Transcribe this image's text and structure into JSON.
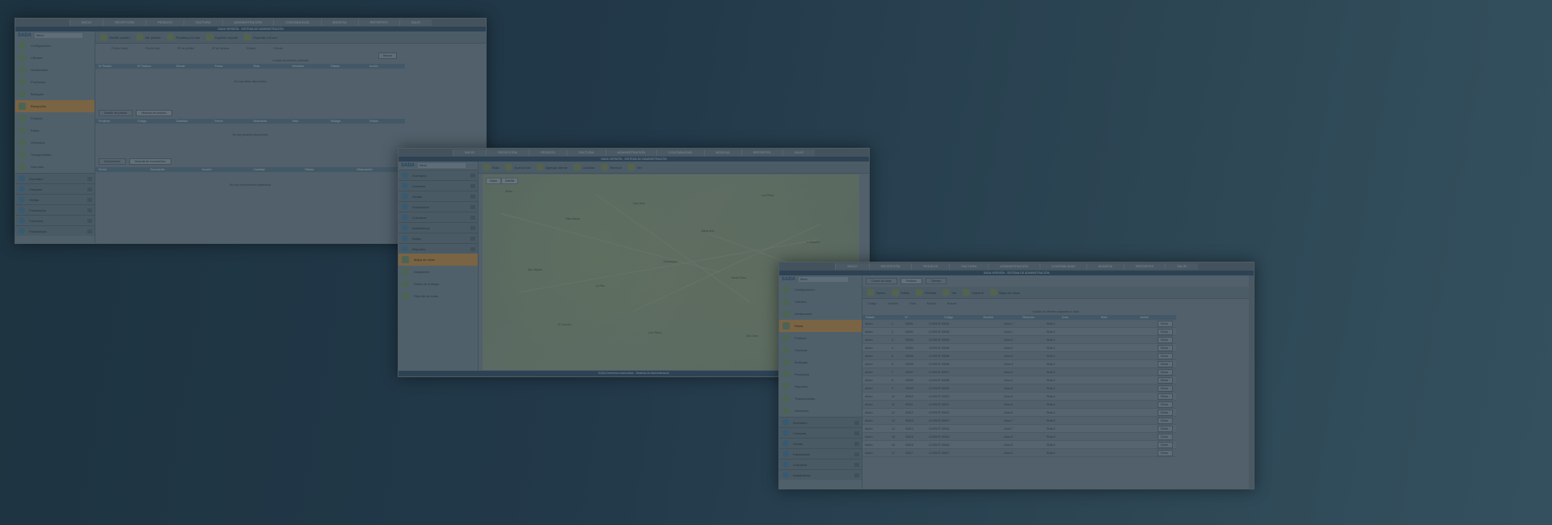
{
  "nav": [
    "INICIO",
    "RECEPCIÓN",
    "PEDIDOS",
    "FACTURA",
    "ADMINISTRACIÓN",
    "CONTABILIDAD",
    "BODEGA",
    "REPORTES",
    "SALIR"
  ],
  "app_title": "SADA VERSIÓN - SISTEMA DE ADMINISTRACIÓN",
  "brand": "SADA",
  "brand_select": "Menú",
  "window1": {
    "toolbar": [
      "Recibir pedido",
      "Ver pedido",
      "Pedidos por ruta",
      "Imprimir reporte",
      "Exportar a Excel"
    ],
    "filters": [
      "Fecha inicial",
      "Fecha final",
      "Nº de pedido",
      "Nº de factura",
      "Estado",
      "Cliente"
    ],
    "search_button": "Buscar",
    "caption": "Listado de pedidos recibidos",
    "columns": [
      "Nº Pedido",
      "Nº Factura",
      "Cliente",
      "Fecha",
      "Ruta",
      "Vendedor",
      "Estado",
      "Acción"
    ],
    "empty": "No hay datos disponibles",
    "tabs1": [
      "Detalle del pedido",
      "Historial de pedidos"
    ],
    "columns2": [
      "Producto",
      "Código",
      "Cantidad",
      "Precio",
      "Descuento",
      "Total",
      "Bodega",
      "Estado"
    ],
    "empty2": "No hay detalles disponibles",
    "tabs2": [
      "Movimientos",
      "Historial de movimientos"
    ],
    "columns3": [
      "Fecha",
      "Documento",
      "Usuario",
      "Cantidad",
      "Estado",
      "Observación"
    ],
    "empty3": "No hay movimientos registrados",
    "sidebar": [
      "Configuración",
      "Clientes",
      "Vendedores",
      "Productos",
      "Bodegas",
      "Recepción",
      "Pedidos",
      "Rutas",
      "Vehículos",
      "Transportistas",
      "Reportes"
    ],
    "groups": [
      "Inventario",
      "Compras",
      "Ventas",
      "Facturación",
      "Cobranza",
      "Estadísticas"
    ]
  },
  "window2": {
    "toolbar": [
      "Ruta",
      "Nueva ruta",
      "Agregar cliente",
      "Guardar",
      "Eliminar",
      "Ver"
    ],
    "map_types": [
      "Mapa",
      "Satélite"
    ],
    "towns": [
      "Aldea",
      "Villa Nueva",
      "San José",
      "Santa Ana",
      "Los Pinos",
      "El Rosario",
      "San Miguel",
      "La Paz",
      "Concepción",
      "Santa Rosa",
      "San Pedro",
      "El Carmen",
      "Las Flores",
      "San Juan"
    ],
    "footer": "SADA Derechos reservados - Sistema de Administración",
    "sidebar": [
      "Mapa de rutas",
      "Asignación",
      "Rutas de entrega",
      "Reporte de rutas"
    ],
    "groups": [
      "Inventario",
      "Compras",
      "Ventas",
      "Facturación",
      "Cobranza",
      "Estadísticas",
      "Rutas",
      "Reportes"
    ]
  },
  "window3": {
    "tabs": [
      "Control de rutas",
      "Pedidos",
      "Clientes"
    ],
    "toolbar": [
      "Nuevo",
      "Editar",
      "Eliminar",
      "Ver",
      "Imprimir",
      "Mapa de rutas"
    ],
    "filters": [
      "Código",
      "Nombre",
      "Ruta",
      "Estado",
      "Buscar"
    ],
    "caption": "Listado de clientes asignados a rutas",
    "columns": [
      "Estado",
      "Nº",
      "Código",
      "Nombre",
      "Dirección",
      "Zona",
      "Ruta",
      "Acción"
    ],
    "rows": [
      [
        "Activo",
        "1",
        "00001",
        "CLIENTE 00001",
        "Zona 1",
        "Ruta 1"
      ],
      [
        "Activo",
        "2",
        "00002",
        "CLIENTE 00002",
        "Zona 1",
        "Ruta 1"
      ],
      [
        "Activo",
        "3",
        "00003",
        "CLIENTE 00003",
        "Zona 2",
        "Ruta 1"
      ],
      [
        "Activo",
        "4",
        "00004",
        "CLIENTE 00004",
        "Zona 2",
        "Ruta 2"
      ],
      [
        "Activo",
        "5",
        "00005",
        "CLIENTE 00005",
        "Zona 3",
        "Ruta 2"
      ],
      [
        "Activo",
        "6",
        "00006",
        "CLIENTE 00006",
        "Zona 3",
        "Ruta 2"
      ],
      [
        "Activo",
        "7",
        "00007",
        "CLIENTE 00007",
        "Zona 4",
        "Ruta 3"
      ],
      [
        "Activo",
        "8",
        "00008",
        "CLIENTE 00008",
        "Zona 4",
        "Ruta 3"
      ],
      [
        "Activo",
        "9",
        "00009",
        "CLIENTE 00009",
        "Zona 5",
        "Ruta 3"
      ],
      [
        "Activo",
        "10",
        "00010",
        "CLIENTE 00010",
        "Zona 5",
        "Ruta 4"
      ],
      [
        "Activo",
        "11",
        "00011",
        "CLIENTE 00011",
        "Zona 6",
        "Ruta 4"
      ],
      [
        "Activo",
        "12",
        "00012",
        "CLIENTE 00012",
        "Zona 6",
        "Ruta 4"
      ],
      [
        "Activo",
        "13",
        "00013",
        "CLIENTE 00013",
        "Zona 7",
        "Ruta 5"
      ],
      [
        "Activo",
        "14",
        "00014",
        "CLIENTE 00014",
        "Zona 7",
        "Ruta 5"
      ],
      [
        "Activo",
        "15",
        "00015",
        "CLIENTE 00015",
        "Zona 8",
        "Ruta 5"
      ],
      [
        "Activo",
        "16",
        "00016",
        "CLIENTE 00016",
        "Zona 8",
        "Ruta 6"
      ],
      [
        "Activo",
        "17",
        "00017",
        "CLIENTE 00017",
        "Zona 9",
        "Ruta 6"
      ]
    ],
    "action_label": "Editar",
    "sidebar": [
      "Configuración",
      "Clientes",
      "Vendedores",
      "Rutas",
      "Pedidos",
      "Facturas",
      "Bodegas",
      "Productos",
      "Reportes",
      "Transportistas",
      "Vehículos"
    ],
    "groups": [
      "Inventario",
      "Compras",
      "Ventas",
      "Facturación",
      "Cobranza",
      "Estadísticas"
    ]
  },
  "colors": {
    "active_menu": "#b88a4c",
    "title_bar": "#3d5566",
    "background": "#22394a"
  }
}
